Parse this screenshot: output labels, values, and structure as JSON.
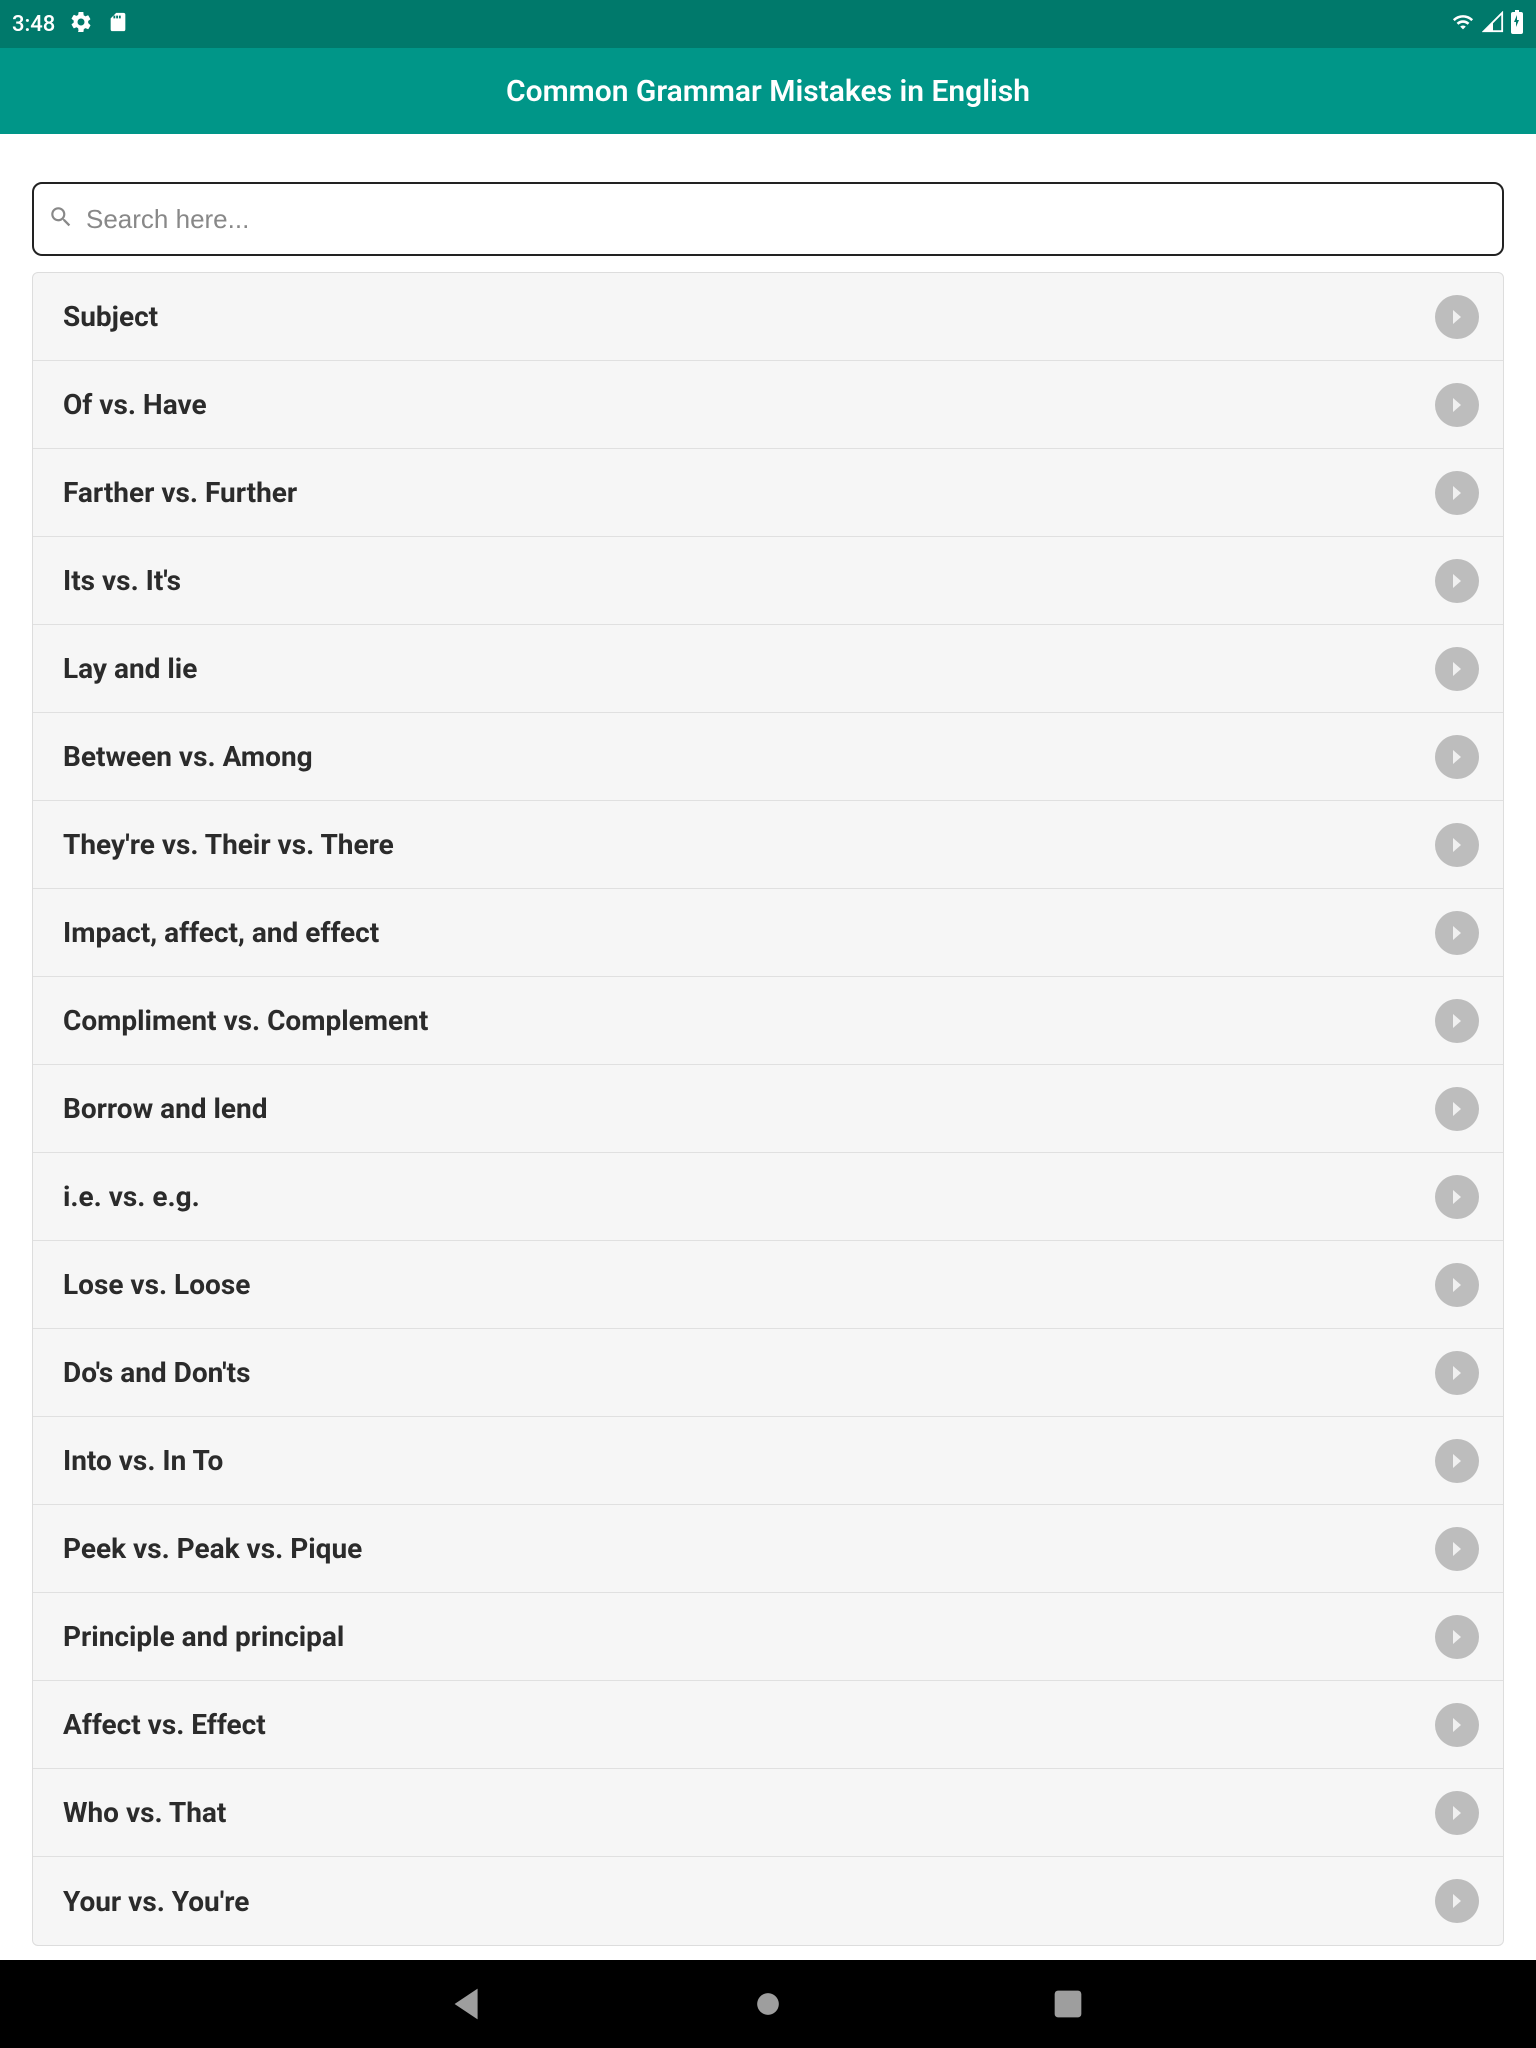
{
  "status": {
    "time": "3:48"
  },
  "header": {
    "title": "Common Grammar Mistakes in English"
  },
  "search": {
    "placeholder": "Search here..."
  },
  "list": {
    "items": [
      {
        "label": "Subject"
      },
      {
        "label": "Of vs. Have"
      },
      {
        "label": "Farther vs. Further"
      },
      {
        "label": "Its vs. It's"
      },
      {
        "label": "Lay and lie"
      },
      {
        "label": "Between vs. Among"
      },
      {
        "label": "They're vs. Their vs. There"
      },
      {
        "label": "Impact, affect, and effect"
      },
      {
        "label": "Compliment vs. Complement"
      },
      {
        "label": "Borrow and lend"
      },
      {
        "label": "i.e. vs. e.g."
      },
      {
        "label": "Lose vs. Loose"
      },
      {
        "label": "Do's and Don'ts"
      },
      {
        "label": "Into vs. In To"
      },
      {
        "label": "Peek vs. Peak vs. Pique"
      },
      {
        "label": "Principle and principal"
      },
      {
        "label": "Affect vs. Effect"
      },
      {
        "label": "Who vs. That"
      },
      {
        "label": "Your vs. You're"
      }
    ]
  }
}
